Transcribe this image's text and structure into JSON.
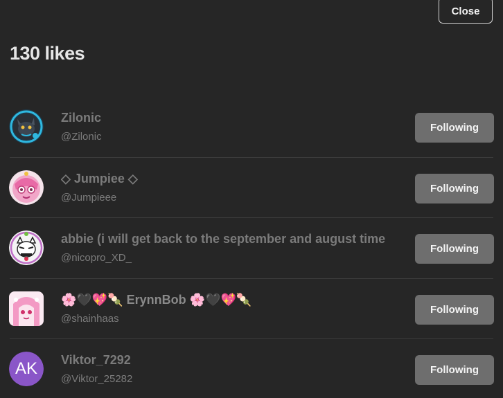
{
  "header": {
    "close_label": "Close",
    "title": "130 likes"
  },
  "likes": [
    {
      "name": "Zilonic",
      "handle": "@Zilonic",
      "button": "Following",
      "avatar": "wolf-character-avatar-icon"
    },
    {
      "name": "◇ Jumpiee ◇",
      "handle": "@Jumpieee",
      "button": "Following",
      "avatar": "pink-character-avatar-icon"
    },
    {
      "name": "abbie (i will get back to the september and august time",
      "handle": "@nicopro_XD_",
      "button": "Following",
      "avatar": "sketch-character-avatar-icon"
    },
    {
      "name": "🌸🖤💖🍡 ErynnBob 🌸🖤💖🍡",
      "handle": "@shainhaas",
      "button": "Following",
      "avatar": "pink-hair-character-avatar-icon"
    },
    {
      "name": "Viktor_7292",
      "handle": "@Viktor_25282",
      "button": "Following",
      "avatar_initials": "AK",
      "avatar_color": "#8a56c8"
    }
  ]
}
